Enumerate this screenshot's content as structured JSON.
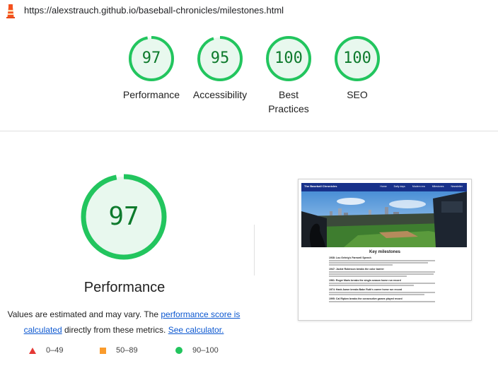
{
  "browser": {
    "url": "https://alexstrauch.github.io/baseball-chronicles/milestones.html"
  },
  "categories": [
    {
      "score": "97",
      "label": "Performance"
    },
    {
      "score": "95",
      "label": "Accessibility"
    },
    {
      "score": "100",
      "label": "Best Practices"
    },
    {
      "score": "100",
      "label": "SEO"
    }
  ],
  "main": {
    "score": "97",
    "title": "Performance",
    "desc_prefix": "Values are estimated and may vary. The ",
    "desc_link1": "performance score is calculated",
    "desc_middle": " directly from these metrics. ",
    "desc_link2": "See calculator."
  },
  "legend": [
    {
      "range": "0–49",
      "marker": "triangle",
      "color": "#e53935"
    },
    {
      "range": "50–89",
      "marker": "square",
      "color": "#fa9b2c"
    },
    {
      "range": "90–100",
      "marker": "circle",
      "color": "#22c55e"
    }
  ],
  "colors": {
    "pass": "#0d7a2c",
    "pass_ring": "#22c55e",
    "pass_fill": "#e8f8ee",
    "link": "#0b57d0"
  },
  "screenshot": {
    "brand": "The Baseball Chronicles",
    "nav": [
      "Home",
      "Daily days",
      "Modern era",
      "Milestones",
      "Newsletter"
    ],
    "heading": "Key milestones",
    "items": [
      "1938: Lou Gehrig's Farewell Speech",
      "1947: Jackie Robinson breaks the color barrier",
      "1961: Roger Maris breaks the single-season home run record",
      "1974: Hank Aaron breaks Babe Ruth's career home run record",
      "1995: Cal Ripken breaks the consecutive games played record"
    ]
  }
}
